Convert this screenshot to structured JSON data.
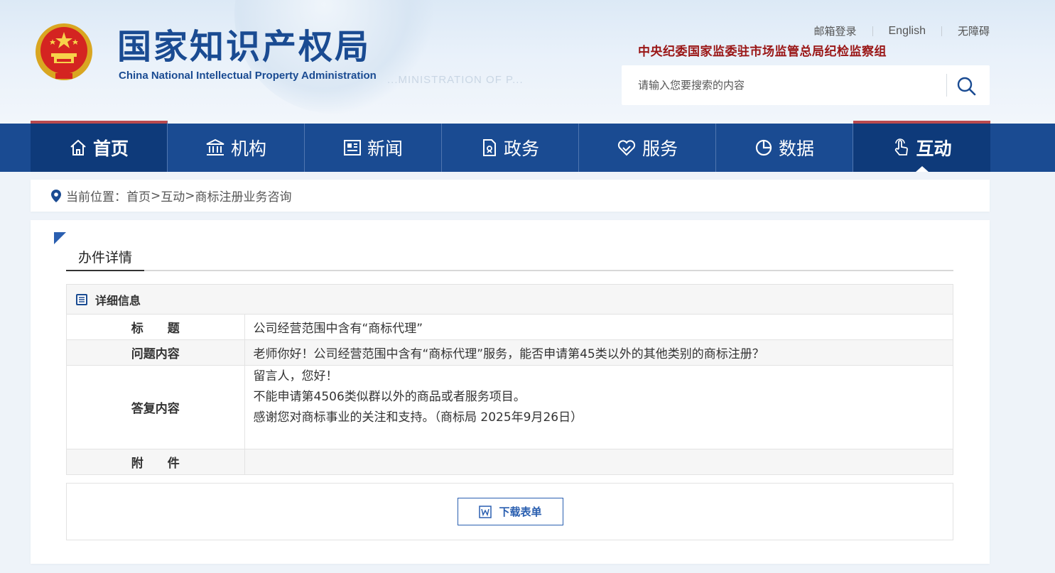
{
  "header": {
    "logo_cn": "国家知识产权局",
    "logo_en": "China National Intellectual Property Administration",
    "watermark": "...MINISTRATION OF P...",
    "top_links": [
      "邮箱登录",
      "English",
      "无障碍"
    ],
    "cdi_text": "中央纪委国家监委驻市场监管总局纪检监察组",
    "search_placeholder": "请输入您要搜索的内容"
  },
  "nav": {
    "items": [
      {
        "label": "首页",
        "icon": "home-icon"
      },
      {
        "label": "机构",
        "icon": "institution-icon"
      },
      {
        "label": "新闻",
        "icon": "news-icon"
      },
      {
        "label": "政务",
        "icon": "government-icon"
      },
      {
        "label": "服务",
        "icon": "service-icon"
      },
      {
        "label": "数据",
        "icon": "data-pie-icon"
      },
      {
        "label": "互动",
        "icon": "touch-icon"
      }
    ],
    "active": "互动"
  },
  "breadcrumb": {
    "prefix": "当前位置：",
    "items": [
      "首页",
      "互动",
      "商标注册业务咨询"
    ],
    "sep": ">"
  },
  "tab": {
    "label": "办件详情"
  },
  "detail": {
    "heading": "详细信息",
    "title_label": "标　　题",
    "title_value": "公司经营范围中含有“商标代理”",
    "question_label": "问题内容",
    "question_value": "老师你好！公司经营范围中含有“商标代理”服务，能否申请第45类以外的其他类别的商标注册？",
    "answer_label": "答复内容",
    "answer_lines": [
      "留言人，您好！",
      "不能申请第4506类似群以外的商品或者服务项目。",
      "感谢您对商标事业的关注和支持。（商标局 2025年9月26日）"
    ],
    "attach_label": "附　　件",
    "attach_value": ""
  },
  "download": {
    "label": "下载表单",
    "icon": "word-file-icon"
  },
  "colors": {
    "primary": "#1a4b92",
    "accent_red": "#b94a4f",
    "link_blue": "#2a5fb0",
    "cdi_red": "#9a1616"
  }
}
